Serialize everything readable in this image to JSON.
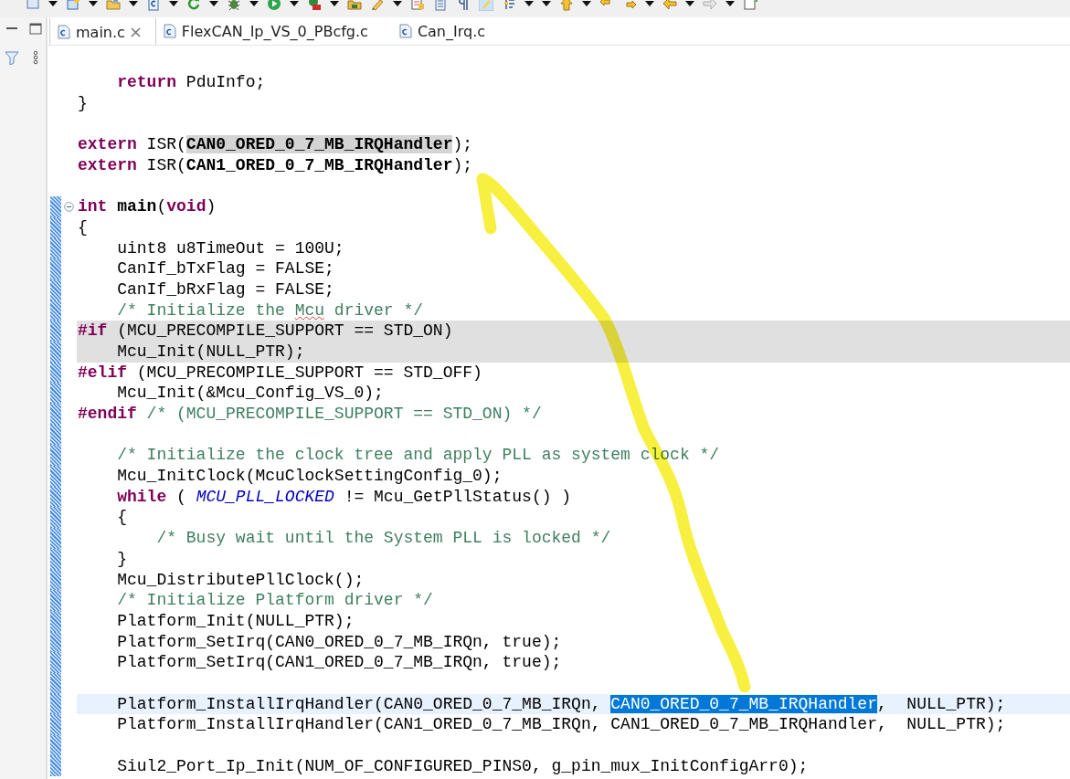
{
  "tabs": [
    {
      "label": "main.c",
      "selected": true
    },
    {
      "label": "FlexCAN_Ip_VS_0_PBcfg.c",
      "selected": false
    },
    {
      "label": "Can_Irq.c",
      "selected": false
    }
  ],
  "code_blocks": [
    [
      {
        "tokens": [
          {
            "kind": "keyword",
            "text": "    return"
          },
          {
            "kind": "plain",
            "text": " PduInfo;"
          }
        ]
      },
      {
        "tokens": [
          {
            "kind": "plain",
            "text": "}"
          }
        ]
      }
    ],
    [
      {
        "tokens": [
          {
            "kind": "keyword",
            "text": "extern"
          },
          {
            "kind": "plain",
            "text": " ISR("
          },
          {
            "kind": "occurrence",
            "text": "CAN0_ORED_0_7_MB_IRQHandler"
          },
          {
            "kind": "plain",
            "text": ");"
          }
        ]
      },
      {
        "tokens": [
          {
            "kind": "keyword",
            "text": "extern"
          },
          {
            "kind": "plain",
            "text": " ISR("
          },
          {
            "kind": "bold",
            "text": "CAN1_ORED_0_7_MB_IRQHandler"
          },
          {
            "kind": "plain",
            "text": ");"
          }
        ]
      }
    ],
    [
      {
        "expanded": true,
        "tokens": [
          {
            "kind": "keyword",
            "text": "int"
          },
          {
            "kind": "bold",
            "text": " main"
          },
          {
            "kind": "plain",
            "text": "("
          },
          {
            "kind": "keyword",
            "text": "void"
          },
          {
            "kind": "plain",
            "text": ")"
          }
        ]
      },
      {
        "tokens": [
          {
            "kind": "plain",
            "text": "{"
          }
        ]
      },
      {
        "tokens": [
          {
            "kind": "plain",
            "text": "    uint8 u8TimeOut = 100U;"
          }
        ]
      },
      {
        "tokens": [
          {
            "kind": "plain",
            "text": "    CanIf_bTxFlag = FALSE;"
          }
        ]
      },
      {
        "tokens": [
          {
            "kind": "plain",
            "text": "    CanIf_bRxFlag = FALSE;"
          }
        ]
      },
      {
        "tokens": [
          {
            "kind": "comment",
            "text": "    /* Initialize the "
          },
          {
            "kind": "misspelled",
            "text": "Mcu"
          },
          {
            "kind": "comment",
            "text": " driver */"
          }
        ]
      },
      {
        "inactive": true,
        "tokens": [
          {
            "kind": "keyword",
            "text": "#if"
          },
          {
            "kind": "plain",
            "text": " (MCU_PRECOMPILE_SUPPORT == STD_ON)"
          }
        ]
      },
      {
        "inactive": true,
        "tokens": [
          {
            "kind": "plain",
            "text": "    Mcu_Init(NULL_PTR);"
          }
        ]
      },
      {
        "tokens": [
          {
            "kind": "keyword",
            "text": "#elif"
          },
          {
            "kind": "plain",
            "text": " (MCU_PRECOMPILE_SUPPORT == STD_OFF)"
          }
        ]
      },
      {
        "tokens": [
          {
            "kind": "plain",
            "text": "    Mcu_Init(&Mcu_Config_VS_0);"
          }
        ]
      },
      {
        "tokens": [
          {
            "kind": "keyword",
            "text": "#endif"
          },
          {
            "kind": "comment",
            "text": " /* (MCU_PRECOMPILE_SUPPORT == STD_ON) */"
          }
        ]
      }
    ],
    [
      {
        "tokens": [
          {
            "kind": "comment",
            "text": "    /* Initialize the clock tree and apply PLL as system clock */"
          }
        ]
      },
      {
        "tokens": [
          {
            "kind": "plain",
            "text": "    Mcu_InitClock(McuClockSettingConfig_0);"
          }
        ]
      },
      {
        "tokens": [
          {
            "kind": "keyword",
            "text": "    while"
          },
          {
            "kind": "plain",
            "text": " ( "
          },
          {
            "kind": "macro",
            "text": "MCU_PLL_LOCKED"
          },
          {
            "kind": "plain",
            "text": " != Mcu_GetPllStatus() )"
          }
        ]
      },
      {
        "tokens": [
          {
            "kind": "plain",
            "text": "    {"
          }
        ]
      },
      {
        "tokens": [
          {
            "kind": "comment",
            "text": "        /* Busy wait until the System PLL is locked */"
          }
        ]
      },
      {
        "tokens": [
          {
            "kind": "plain",
            "text": "    }"
          }
        ]
      },
      {
        "tokens": [
          {
            "kind": "plain",
            "text": "    Mcu_DistributePllClock();"
          }
        ]
      },
      {
        "tokens": [
          {
            "kind": "comment",
            "text": "    /* Initialize Platform driver */"
          }
        ]
      },
      {
        "tokens": [
          {
            "kind": "plain",
            "text": "    Platform_Init(NULL_PTR);"
          }
        ]
      },
      {
        "tokens": [
          {
            "kind": "plain",
            "text": "    Platform_SetIrq(CAN0_ORED_0_7_MB_IRQn, true);"
          }
        ]
      },
      {
        "tokens": [
          {
            "kind": "plain",
            "text": "    Platform_SetIrq(CAN1_ORED_0_7_MB_IRQn, true);"
          }
        ]
      }
    ],
    [
      {
        "current": true,
        "tokens": [
          {
            "kind": "plain",
            "text": "    Platform_InstallIrqHandler(CAN0_ORED_0_7_MB_IRQn, "
          },
          {
            "kind": "selection",
            "text": "CAN0_ORED_0_7_MB_IRQHandler"
          },
          {
            "kind": "plain",
            "text": ",  NULL_PTR);"
          }
        ]
      },
      {
        "tokens": [
          {
            "kind": "plain",
            "text": "    Platform_InstallIrqHandler(CAN1_ORED_0_7_MB_IRQn, CAN1_ORED_0_7_MB_IRQHandler,  NULL_PTR);"
          }
        ]
      }
    ],
    [
      {
        "tokens": [
          {
            "kind": "plain",
            "text": "    Siul2_Port_Ip_Init(NUM_OF_CONFIGURED_PINS0, g_pin_mux_InitConfigArr0);"
          }
        ]
      }
    ]
  ]
}
